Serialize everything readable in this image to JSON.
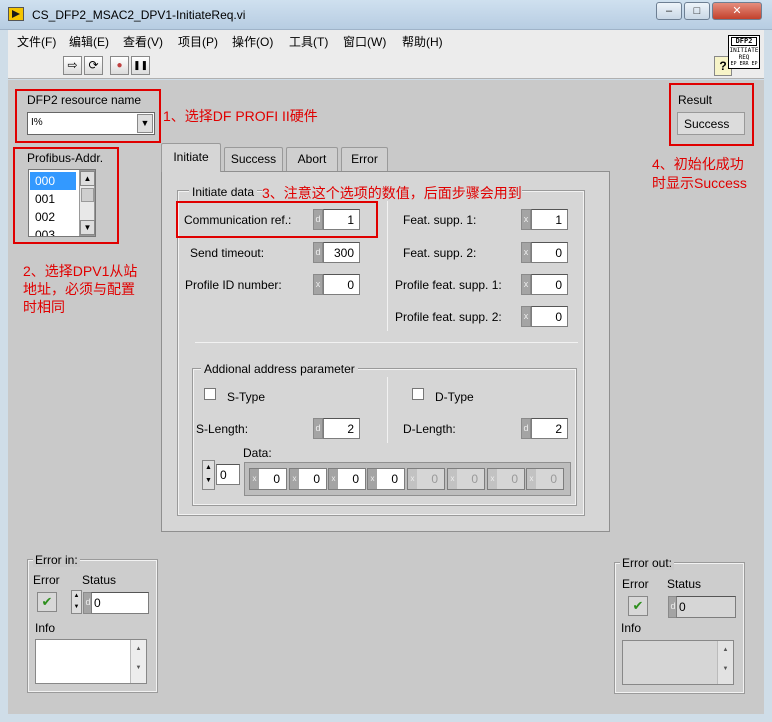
{
  "window": {
    "title": "CS_DFP2_MSAC2_DPV1-InitiateReq.vi",
    "minimize": "–",
    "maximize": "□",
    "close": "✕"
  },
  "menu": [
    "文件(F)",
    "编辑(E)",
    "查看(V)",
    "项目(P)",
    "操作(O)",
    "工具(T)",
    "窗口(W)",
    "帮助(H)"
  ],
  "toolbar": {
    "run": "⇨",
    "run_continuous": "⟳",
    "abort": "●",
    "pause": "❚❚",
    "help": "?"
  },
  "vi_icon": {
    "line1": "DFP2",
    "line2": "INITIATE",
    "line3": "REQ",
    "line4": "EP ERR EP"
  },
  "resource": {
    "label": "DFP2 resource name",
    "value": "",
    "prefix": "I%"
  },
  "profibus": {
    "label": "Profibus-Addr.",
    "items": [
      "000",
      "001",
      "002",
      "003"
    ],
    "selected": "000"
  },
  "result": {
    "label": "Result",
    "value": "Success"
  },
  "tabs": [
    "Initiate",
    "Success",
    "Abort",
    "Error"
  ],
  "active_tab": "Initiate",
  "initiate": {
    "group_label": "Initiate data",
    "comm_ref": {
      "label": "Communication ref.:",
      "radix": "d",
      "value": "1"
    },
    "send_timeout": {
      "label": "Send timeout:",
      "radix": "d",
      "value": "300"
    },
    "profile_id": {
      "label": "Profile ID number:",
      "radix": "x",
      "value": "0"
    },
    "feat1": {
      "label": "Feat. supp. 1:",
      "radix": "x",
      "value": "1"
    },
    "feat2": {
      "label": "Feat. supp. 2:",
      "radix": "x",
      "value": "0"
    },
    "pfeat1": {
      "label": "Profile feat. supp. 1:",
      "radix": "x",
      "value": "0"
    },
    "pfeat2": {
      "label": "Profile feat. supp. 2:",
      "radix": "x",
      "value": "0"
    },
    "addr_group": "Addional address parameter",
    "s_type": "S-Type",
    "d_type": "D-Type",
    "s_length": {
      "label": "S-Length:",
      "radix": "d",
      "value": "2"
    },
    "d_length": {
      "label": "D-Length:",
      "radix": "d",
      "value": "2"
    },
    "data_label": "Data:",
    "data_index": "0",
    "data_values": [
      "0",
      "0",
      "0",
      "0",
      "0",
      "0",
      "0",
      "0"
    ],
    "data_radix": "x"
  },
  "error_in": {
    "label": "Error in:",
    "error": "Error",
    "status": "Status",
    "status_value": "0",
    "status_radix": "d",
    "check": "✔",
    "info": "Info"
  },
  "error_out": {
    "label": "Error out:",
    "error": "Error",
    "status": "Status",
    "status_value": "0",
    "status_radix": "d",
    "check": "✔",
    "info": "Info"
  },
  "annotations": {
    "a1": "1、选择DF PROFI II硬件",
    "a2_l1": "2、选择DPV1从站",
    "a2_l2": "地址，必须与配置",
    "a2_l3": "时相同",
    "a3": "3、注意这个选项的数值，后面步骤会用到",
    "a4_l1": "4、初始化成功",
    "a4_l2": "时显示Success"
  },
  "colors": {
    "annotation": "#e00000",
    "panel": "#c9c9c9",
    "list_selected": "#3399ff"
  }
}
